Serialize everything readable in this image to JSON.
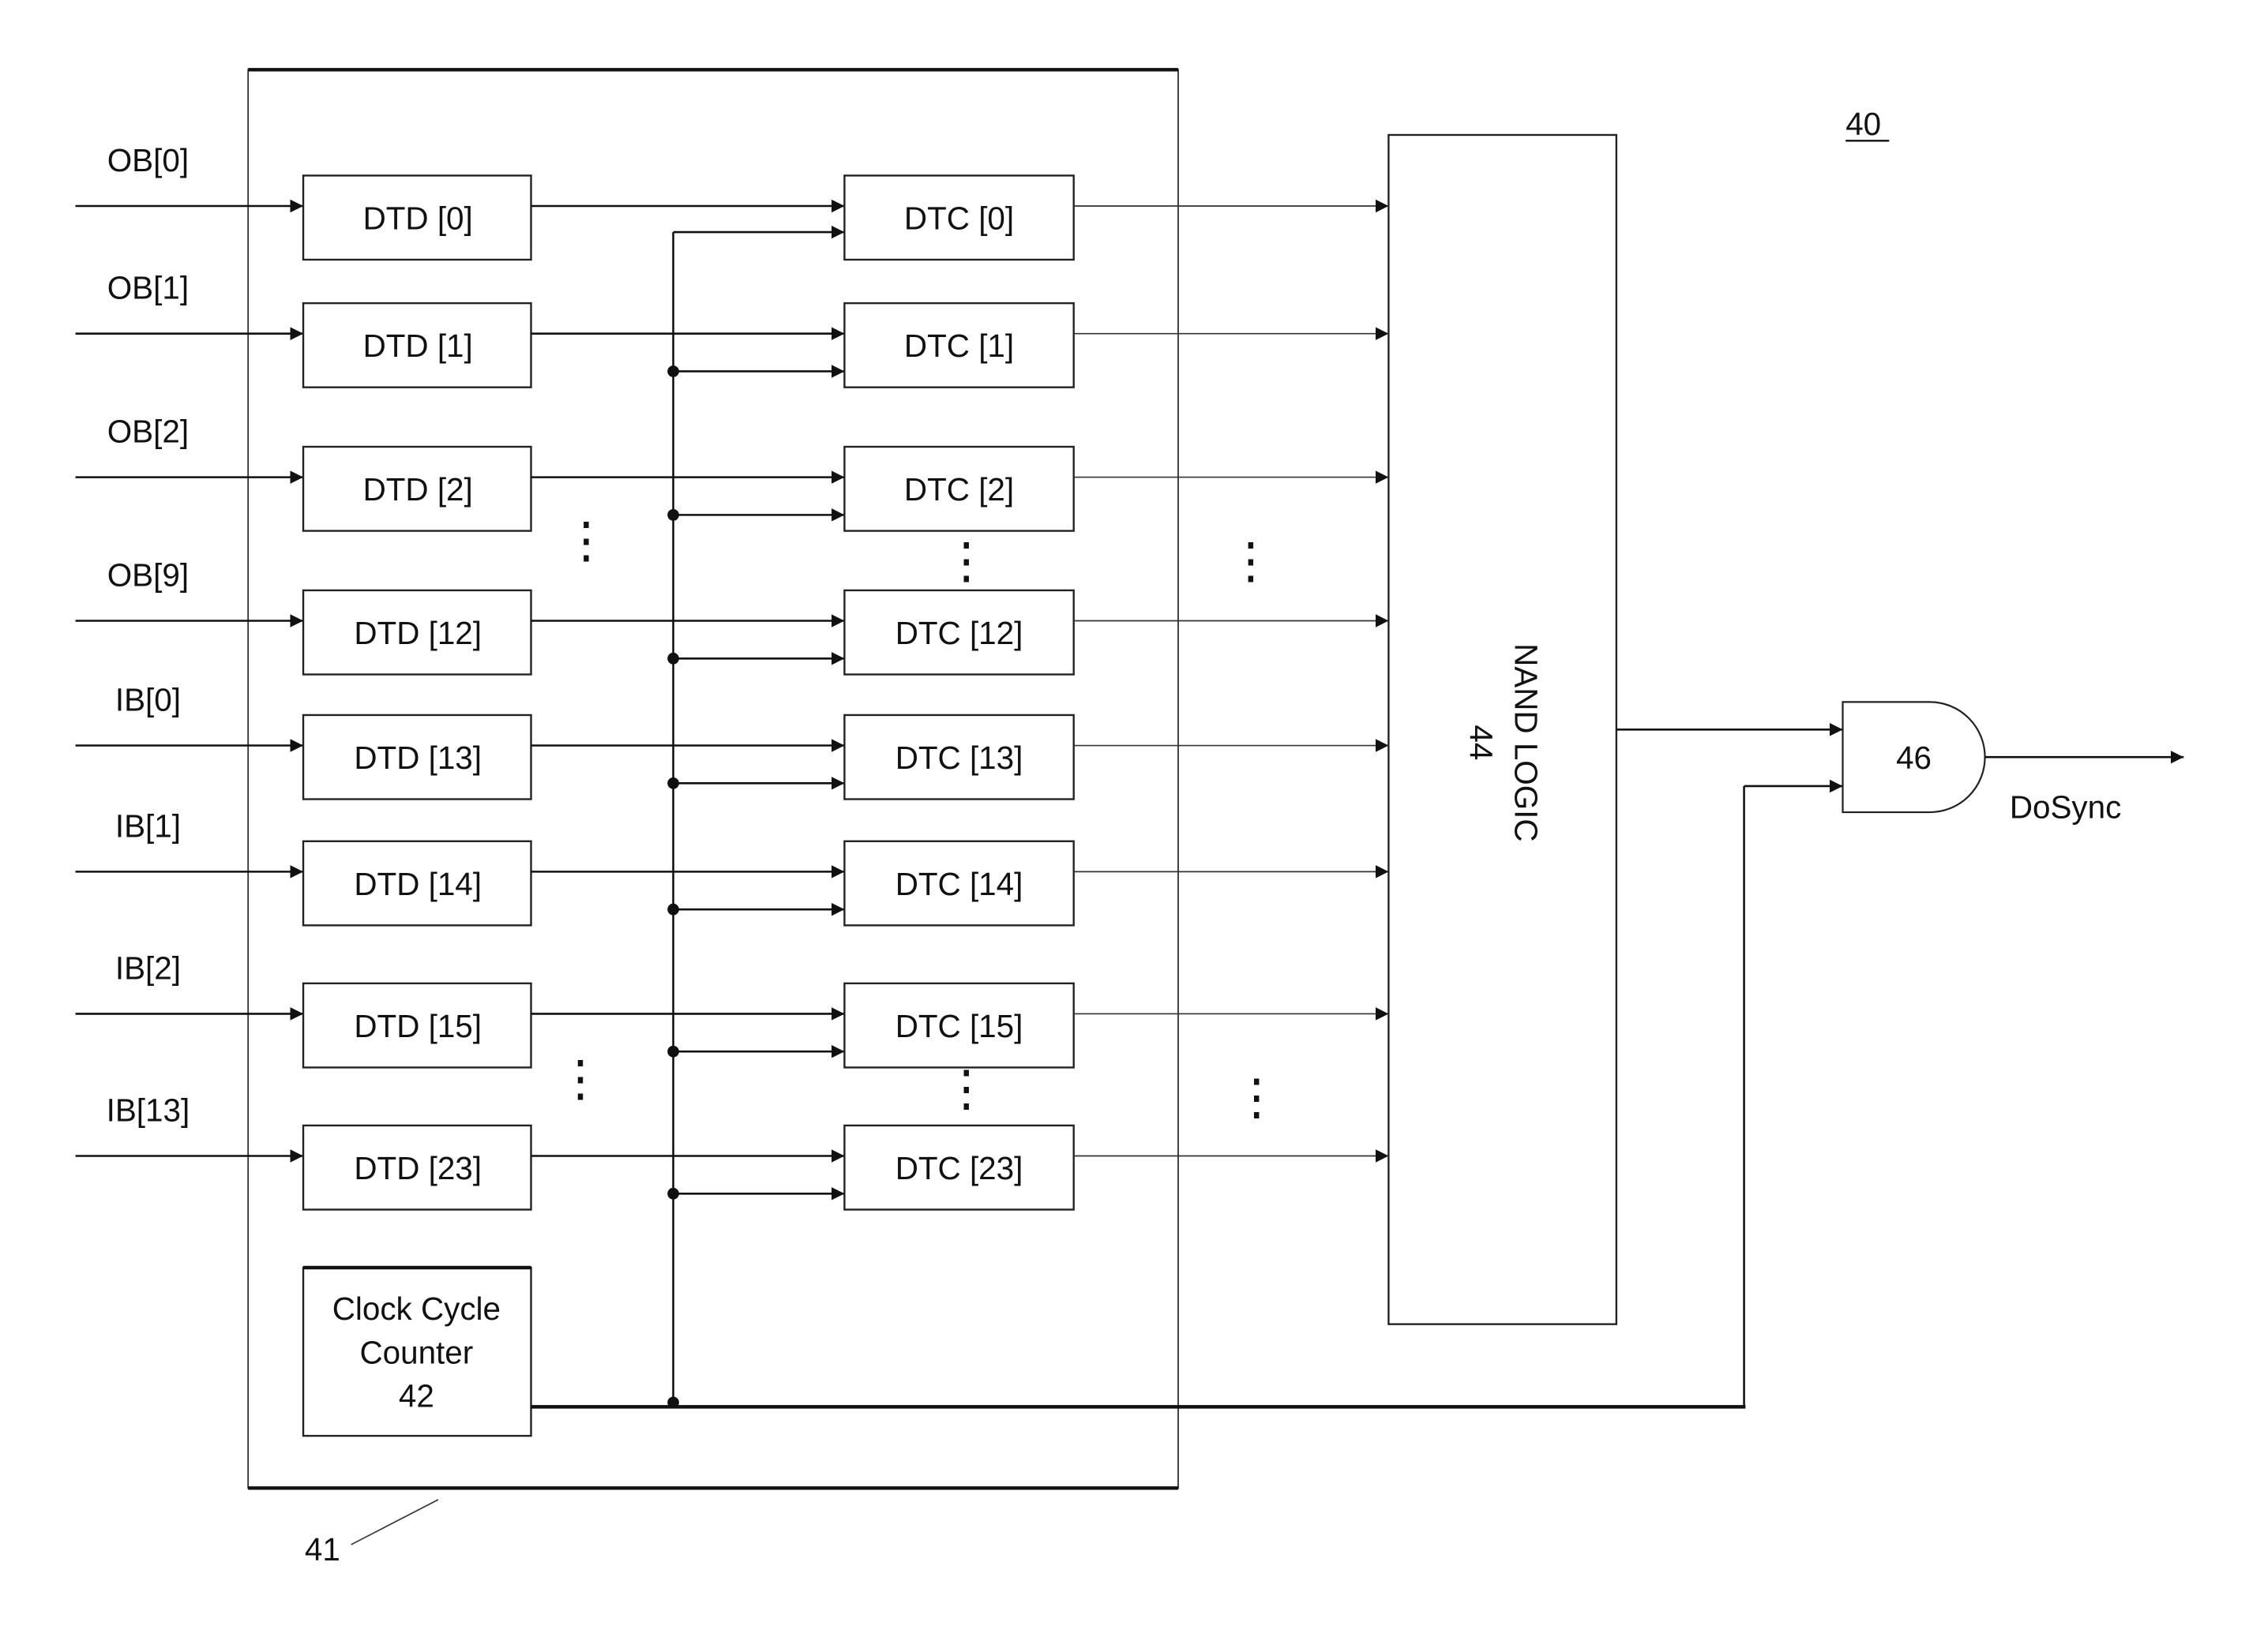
{
  "figure_label": "40",
  "group_label": "41",
  "inputs": [
    "OB[0]",
    "OB[1]",
    "OB[2]",
    "OB[9]",
    "IB[0]",
    "IB[1]",
    "IB[2]",
    "IB[13]"
  ],
  "dtd_blocks": [
    "DTD [0]",
    "DTD [1]",
    "DTD [2]",
    "DTD [12]",
    "DTD [13]",
    "DTD [14]",
    "DTD [15]",
    "DTD [23]"
  ],
  "dtc_blocks": [
    "DTC [0]",
    "DTC [1]",
    "DTC [2]",
    "DTC [12]",
    "DTC [13]",
    "DTC [14]",
    "DTC [15]",
    "DTC [23]"
  ],
  "counter": {
    "line1": "Clock Cycle",
    "line2": "Counter",
    "line3": "42"
  },
  "nand": {
    "title": "NAND LOGIC",
    "number": "44"
  },
  "gate": {
    "number": "46",
    "output_label": "DoSync"
  },
  "ellipsis": "⋮"
}
